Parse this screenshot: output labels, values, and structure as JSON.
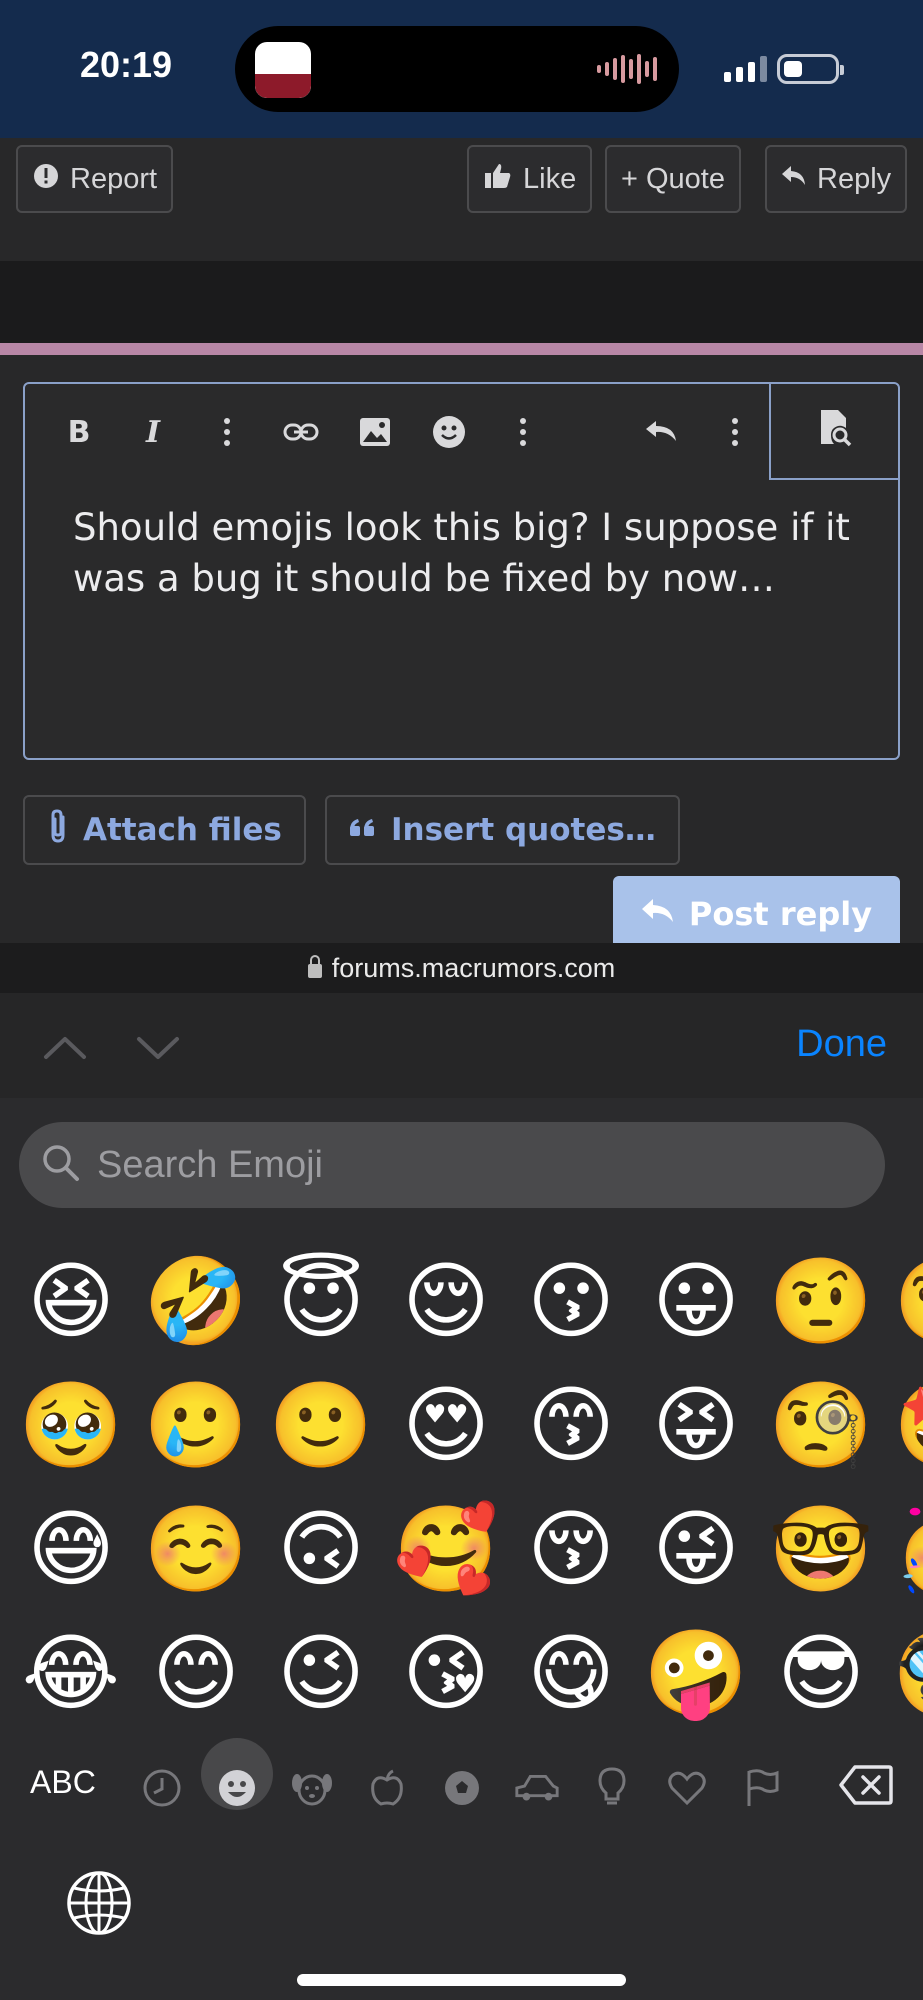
{
  "status_bar": {
    "time": "20:19"
  },
  "post_actions": {
    "report": "Report",
    "like": "Like",
    "quote": "+ Quote",
    "reply": "Reply"
  },
  "editor": {
    "text": "Should emojis look this big? I suppose if it was a bug it should be fixed by now…",
    "toolbar_icons": [
      "bold-icon",
      "italic-icon",
      "more-icon",
      "link-icon",
      "image-icon",
      "smiley-icon",
      "more-icon",
      "undo-icon",
      "more-icon",
      "preview-icon"
    ]
  },
  "attach_button": "Attach files",
  "insert_quotes_button": "Insert quotes…",
  "post_reply_button": "Post reply",
  "url_bar": {
    "domain": "forums.macrumors.com"
  },
  "accessory": {
    "done": "Done"
  },
  "emoji_keyboard": {
    "search_placeholder": "Search Emoji",
    "abc_label": "ABC",
    "rows": [
      [
        "😆",
        "🤣",
        "😇",
        "😌",
        "😗",
        "😛",
        "🤨",
        "🧐"
      ],
      [
        "🥹",
        "🥲",
        "🙂",
        "😍",
        "😙",
        "😝",
        "🧐",
        "🤩"
      ],
      [
        "😅",
        "☺️",
        "🙃",
        "🥰",
        "😚",
        "😜",
        "🤓",
        "🥳"
      ],
      [
        "😂",
        "😊",
        "😉",
        "😘",
        "😋",
        "🤪",
        "😎",
        "🥸"
      ]
    ],
    "categories": [
      "clock-icon",
      "smiley-icon",
      "dog-icon",
      "apple-icon",
      "soccer-icon",
      "car-icon",
      "lightbulb-icon",
      "heart-icon",
      "flag-icon"
    ],
    "active_category": "smiley-icon"
  },
  "colors": {
    "status_bar_bg": "#142b4d",
    "accent_line": "#b887a6",
    "link_blue": "#8da9e0",
    "post_button": "#a9c2ea",
    "done_blue": "#0a84ff"
  }
}
